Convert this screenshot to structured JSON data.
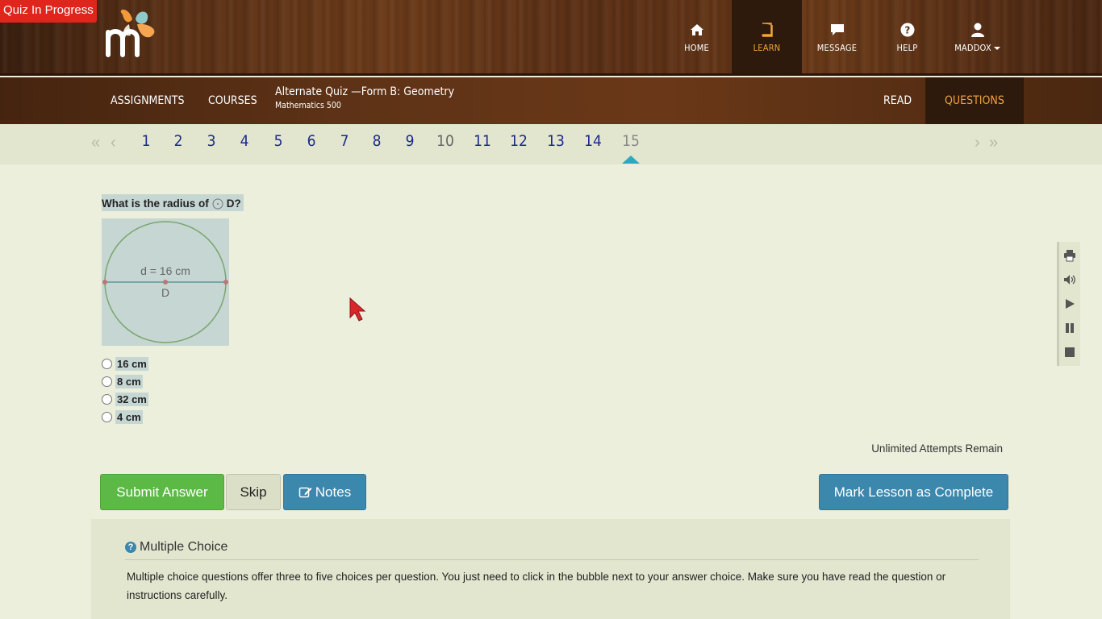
{
  "status": {
    "quiz_badge": "Quiz In Progress"
  },
  "topnav": {
    "items": [
      {
        "label": "HOME",
        "icon": "home-icon"
      },
      {
        "label": "LEARN",
        "icon": "book-icon"
      },
      {
        "label": "MESSAGE",
        "icon": "message-icon"
      },
      {
        "label": "HELP",
        "icon": "help-icon"
      },
      {
        "label": "MADDOX",
        "icon": "user-icon"
      }
    ]
  },
  "subnav": {
    "assignments": "ASSIGNMENTS",
    "courses": "COURSES",
    "lesson_title": "Alternate Quiz —Form B: Geometry",
    "course_name": "Mathematics 500",
    "read": "READ",
    "questions": "QUESTIONS"
  },
  "pager": {
    "pages": [
      "1",
      "2",
      "3",
      "4",
      "5",
      "6",
      "7",
      "8",
      "9",
      "10",
      "11",
      "12",
      "13",
      "14",
      "15"
    ],
    "current": "15"
  },
  "question": {
    "prompt_before": "What is the radius of",
    "prompt_after": "D?",
    "figure": {
      "diameter_label": "d = 16 cm",
      "center_label": "D"
    },
    "choices": [
      "16 cm",
      "8 cm",
      "32 cm",
      "4 cm"
    ]
  },
  "attempts": "Unlimited Attempts Remain",
  "buttons": {
    "submit": "Submit Answer",
    "skip": "Skip",
    "notes": "Notes",
    "complete": "Mark Lesson as Complete"
  },
  "info": {
    "title": "Multiple Choice",
    "body": "Multiple choice questions offer three to five choices per question. You just need to click in the bubble next to your answer choice. Make sure you have read the question or instructions carefully."
  },
  "colors": {
    "accent_orange": "#f0a43a",
    "submit_green": "#5cb946",
    "action_blue": "#3c87ac",
    "badge_red": "#e0261c"
  }
}
